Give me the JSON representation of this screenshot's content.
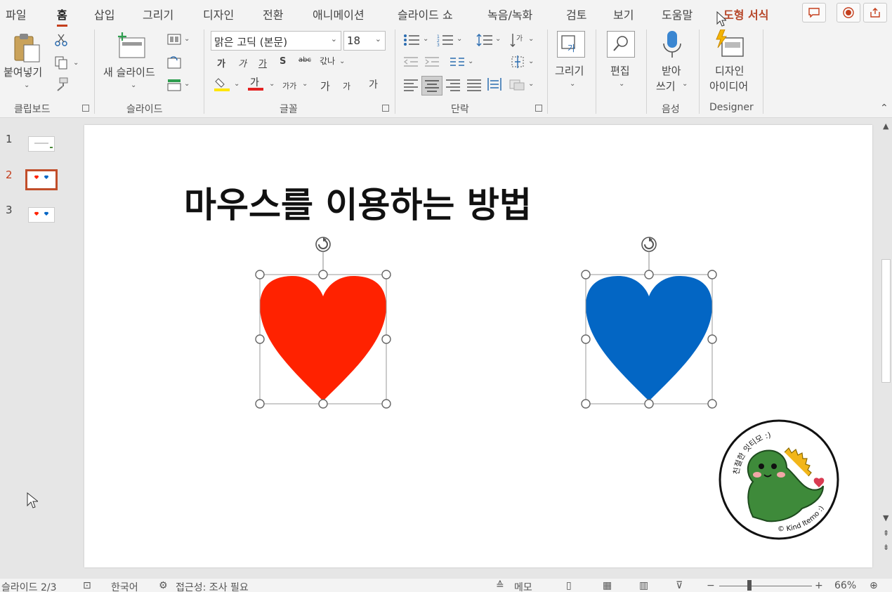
{
  "tabs": [
    {
      "label": "파일"
    },
    {
      "label": "홈"
    },
    {
      "label": "삽입"
    },
    {
      "label": "그리기"
    },
    {
      "label": "디자인"
    },
    {
      "label": "전환"
    },
    {
      "label": "애니메이션"
    },
    {
      "label": "슬라이드 쇼"
    },
    {
      "label": "녹음/녹화"
    },
    {
      "label": "검토"
    },
    {
      "label": "보기"
    },
    {
      "label": "도움말"
    },
    {
      "label": "도형 서식"
    }
  ],
  "ribbon": {
    "clipboard": {
      "paste_label": "붙여넣기",
      "group_label": "클립보드"
    },
    "slides": {
      "new_slide_label": "새 슬라이드",
      "group_label": "슬라이드"
    },
    "font": {
      "font_name": "맑은 고딕 (본문)",
      "font_size": "18",
      "group_label": "글꼴",
      "bold": "가",
      "italic": "가",
      "underline": "가",
      "shadow": "S",
      "strike": "abc",
      "spacing": "갃나",
      "grow": "가",
      "shrink": "가",
      "case": "가가",
      "clear": "가"
    },
    "paragraph": {
      "group_label": "단락"
    },
    "drawing": {
      "label": "그리기"
    },
    "editing": {
      "label": "편집"
    },
    "voice": {
      "label_line1": "받아",
      "label_line2": "쓰기",
      "group_label": "음성"
    },
    "designer": {
      "label_line1": "디자인",
      "label_line2": "아이디어",
      "group_label": "Designer"
    }
  },
  "thumbnails": [
    {
      "number": "1"
    },
    {
      "number": "2"
    },
    {
      "number": "3"
    }
  ],
  "slide": {
    "title": "마우스를 이용하는 방법",
    "heart_left_color": "#ff2200",
    "heart_right_color": "#0366c4",
    "sticker_text_top": "친절한 잇티모 :)",
    "sticker_text_bottom": "© Kind Itemo :)"
  },
  "status": {
    "slide_info": "슬라이드 2/3",
    "language": "한국어",
    "accessibility": "접근성: 조사 필요",
    "notes": "메모",
    "zoom": "66%"
  },
  "colors": {
    "accent": "#c43e1c",
    "context_tab": "#b7472a"
  }
}
